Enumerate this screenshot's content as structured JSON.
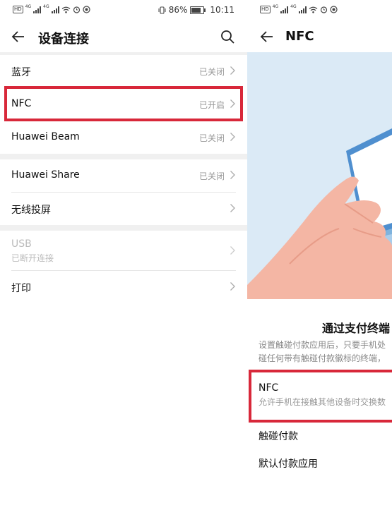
{
  "left": {
    "status": {
      "time": "10:11",
      "battery_pct": "86%",
      "hd": "HD",
      "net": "4G"
    },
    "header": {
      "title": "设备连接"
    },
    "groups": [
      [
        {
          "label": "蓝牙",
          "value": "已关闭"
        },
        {
          "label": "NFC",
          "value": "已开启"
        },
        {
          "label": "Huawei Beam",
          "value": "已关闭"
        }
      ],
      [
        {
          "label": "Huawei Share",
          "value": "已关闭"
        },
        {
          "label": "无线投屏",
          "value": ""
        }
      ],
      [
        {
          "label": "USB",
          "sublabel": "已断开连接"
        },
        {
          "label": "打印"
        }
      ]
    ]
  },
  "right": {
    "status": {
      "hd": "HD",
      "net": "4G"
    },
    "header": {
      "title": "NFC"
    },
    "section_title": "通过支付终端",
    "description": [
      "设置触碰付款应用后，只要手机处",
      "碰任何带有触碰付款徽标的终端，"
    ],
    "nfc": {
      "label": "NFC",
      "sublabel": "允许手机在接触其他设备时交换数"
    },
    "tap_pay": {
      "label": "触碰付款"
    },
    "default_app": {
      "label": "默认付款应用"
    }
  },
  "colors": {
    "highlight": "#d8283a",
    "illustration_bg": "#dbeaf6",
    "separator": "#f0f0f0"
  }
}
